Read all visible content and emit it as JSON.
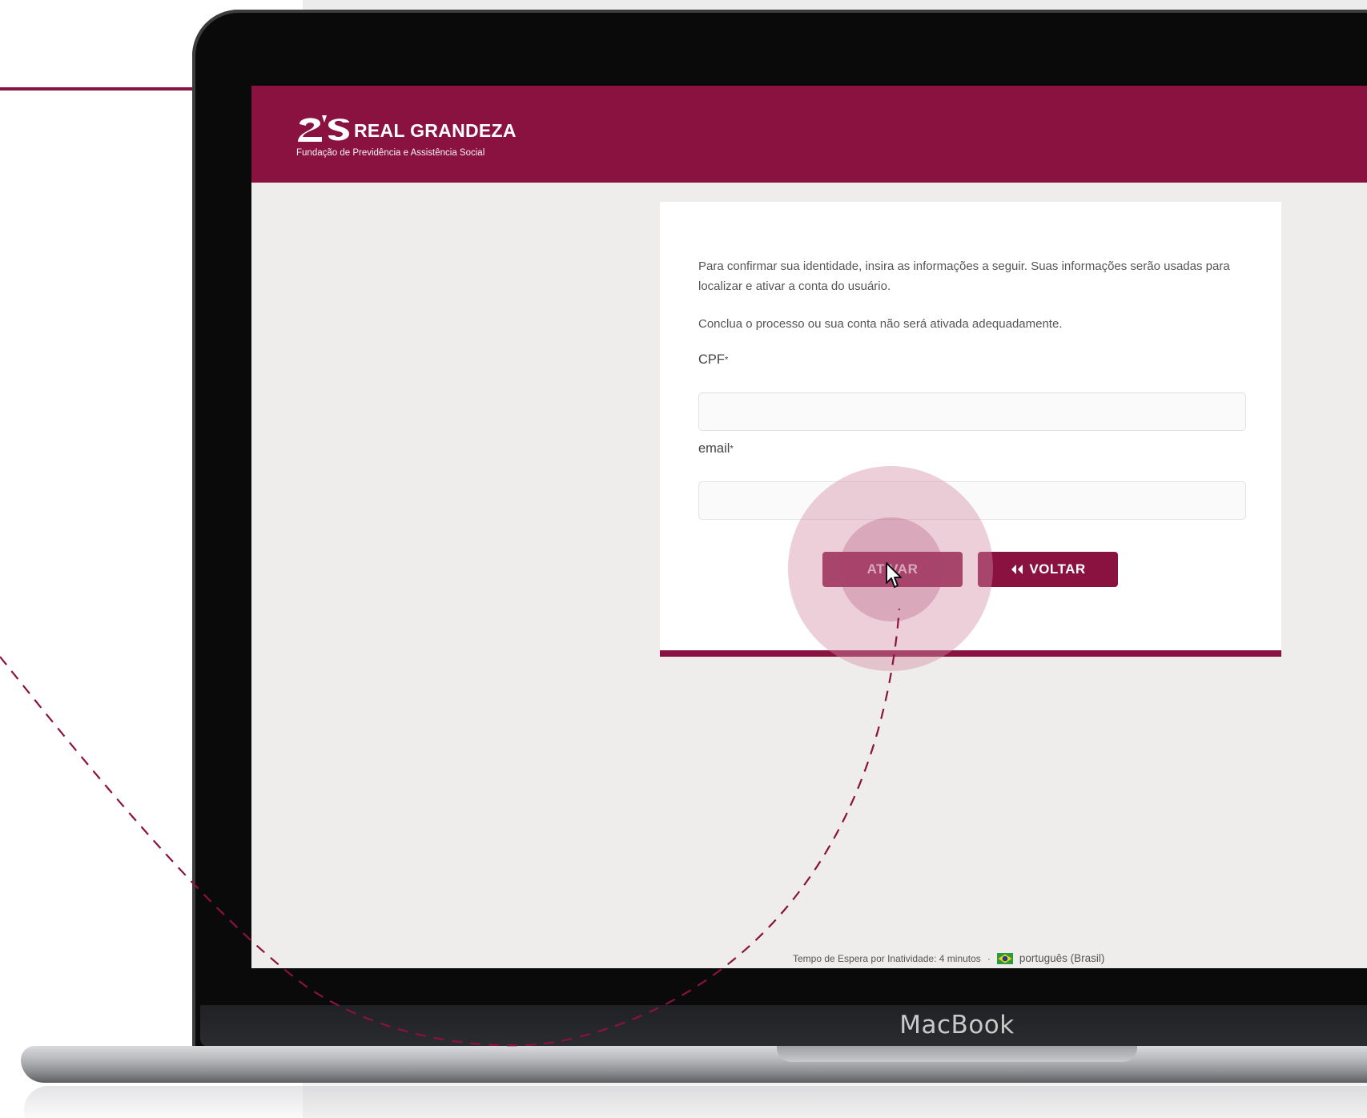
{
  "brand": {
    "name": "REAL GRANDEZA",
    "subtitle": "Fundação de Previdência e Assistência Social",
    "color": "#8a1240"
  },
  "form": {
    "intro_1": "Para confirmar sua identidade, insira as informações a seguir. Suas informações serão usadas para localizar e ativar a conta do usuário.",
    "intro_2": "Conclua o processo ou sua conta não será ativada adequadamente.",
    "cpf_label": "CPF",
    "email_label": "email",
    "required_mark": "*",
    "cpf_value": "",
    "email_value": "",
    "ativar_label": "ATIVAR",
    "voltar_icon": "double-chevron-left-icon",
    "voltar_label": "VOLTAR"
  },
  "footer": {
    "timeout_text": "Tempo de Espera por Inatividade: 4 minutos",
    "separator": "·",
    "flag_icon": "brazil-flag-icon",
    "language": "português (Brasil)"
  },
  "device": {
    "label": "MacBook"
  },
  "colors": {
    "accent": "#8a1240",
    "screen_bg": "#efedeb",
    "click_highlight": "#d28ca5"
  }
}
